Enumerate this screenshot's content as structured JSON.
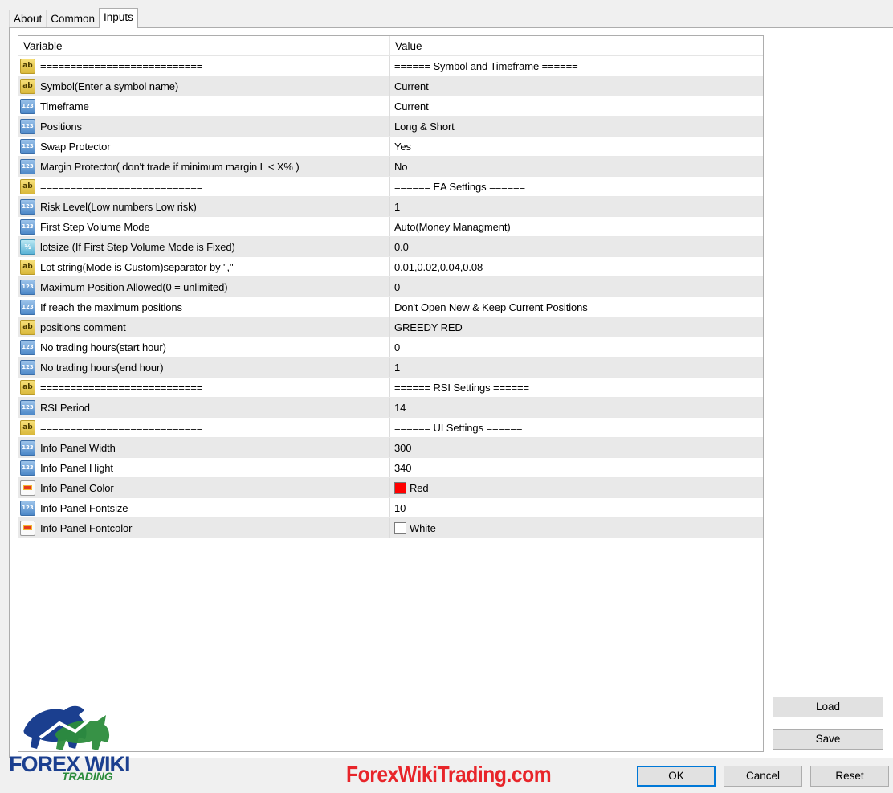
{
  "tabs": [
    {
      "label": "About",
      "active": false
    },
    {
      "label": "Common",
      "active": false
    },
    {
      "label": "Inputs",
      "active": true
    }
  ],
  "table": {
    "headers": [
      "Variable",
      "Value"
    ],
    "rows": [
      {
        "icon": "ab",
        "variable": "===========================",
        "value": "====== Symbol and Timeframe ======"
      },
      {
        "icon": "ab",
        "variable": "Symbol(Enter a symbol name)",
        "value": "Current"
      },
      {
        "icon": "123",
        "variable": "Timeframe",
        "value": "Current"
      },
      {
        "icon": "123",
        "variable": "Positions",
        "value": "Long & Short"
      },
      {
        "icon": "123",
        "variable": "Swap Protector",
        "value": "Yes"
      },
      {
        "icon": "123",
        "variable": "Margin Protector( don't trade if minimum margin L < X% )",
        "value": "No"
      },
      {
        "icon": "ab",
        "variable": "===========================",
        "value": "====== EA Settings ======"
      },
      {
        "icon": "123",
        "variable": "Risk Level(Low numbers Low risk)",
        "value": "1"
      },
      {
        "icon": "123",
        "variable": "First Step Volume Mode",
        "value": "Auto(Money Managment)"
      },
      {
        "icon": "half",
        "variable": "lotsize (If First Step Volume Mode is Fixed)",
        "value": "0.0"
      },
      {
        "icon": "ab",
        "variable": "Lot string(Mode is Custom)separator by \",\"",
        "value": "0.01,0.02,0.04,0.08"
      },
      {
        "icon": "123",
        "variable": "Maximum Position Allowed(0 = unlimited)",
        "value": "0"
      },
      {
        "icon": "123",
        "variable": "If reach the maximum positions",
        "value": "Don't Open New & Keep Current Positions"
      },
      {
        "icon": "ab",
        "variable": "positions  comment",
        "value": "GREEDY RED"
      },
      {
        "icon": "123",
        "variable": "No trading hours(start hour)",
        "value": "0"
      },
      {
        "icon": "123",
        "variable": "No trading hours(end hour)",
        "value": "1"
      },
      {
        "icon": "ab",
        "variable": "===========================",
        "value": "====== RSI Settings ======"
      },
      {
        "icon": "123",
        "variable": "RSI Period",
        "value": "14"
      },
      {
        "icon": "ab",
        "variable": "===========================",
        "value": "====== UI Settings ======"
      },
      {
        "icon": "123",
        "variable": "Info Panel Width",
        "value": "300"
      },
      {
        "icon": "123",
        "variable": "Info Panel Hight",
        "value": "340"
      },
      {
        "icon": "color",
        "variable": "Info Panel Color",
        "value": "Red",
        "swatch": "#ff0000"
      },
      {
        "icon": "123",
        "variable": "Info Panel Fontsize",
        "value": "10"
      },
      {
        "icon": "color",
        "variable": "Info Panel Fontcolor",
        "value": "White",
        "swatch": "#ffffff"
      }
    ]
  },
  "buttons": {
    "load": "Load",
    "save": "Save",
    "ok": "OK",
    "cancel": "Cancel",
    "reset": "Reset"
  },
  "branding": {
    "logo_line1": "FOREX WIKI",
    "logo_line2": "TRADING",
    "watermark": "ForexWikiTrading.com"
  },
  "colors": {
    "accent": "#0078d7",
    "watermark": "#e8252a",
    "logo_blue": "#1b3f8f",
    "logo_green": "#2c8c3c"
  }
}
